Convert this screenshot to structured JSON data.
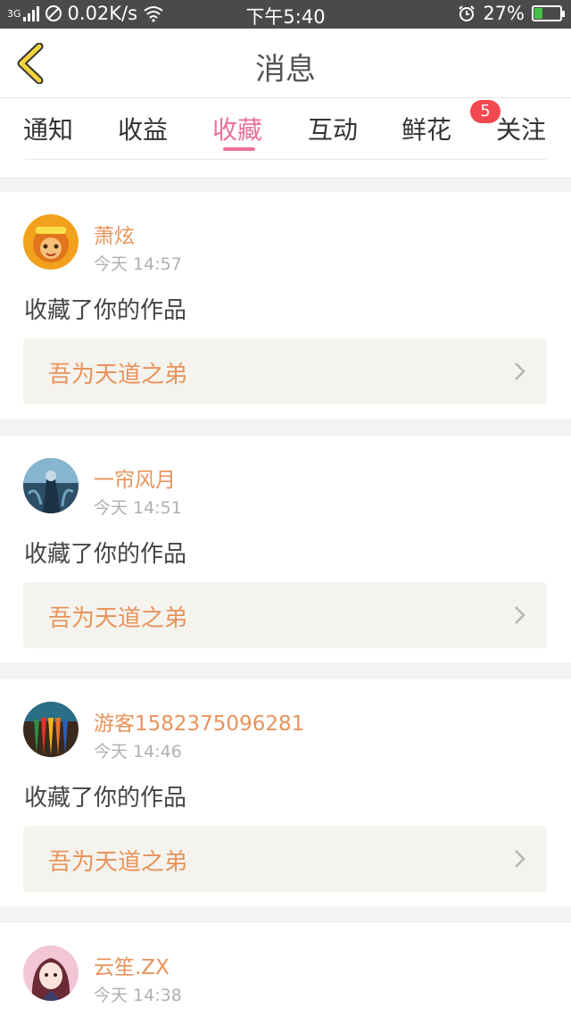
{
  "status_bar": {
    "network": "3G",
    "speed": "0.02K/s",
    "time": "下午5:40",
    "battery": "27%"
  },
  "header": {
    "title": "消息"
  },
  "tabs": [
    {
      "label": "通知"
    },
    {
      "label": "收益"
    },
    {
      "label": "收藏",
      "badge": "5"
    },
    {
      "label": "互动"
    },
    {
      "label": "鲜花"
    },
    {
      "label": "关注"
    }
  ],
  "messages": [
    {
      "user": "萧炫",
      "time": "今天 14:57",
      "action": "收藏了你的作品",
      "work": "吾为天道之弟"
    },
    {
      "user": "一帘风月",
      "time": "今天 14:51",
      "action": "收藏了你的作品",
      "work": "吾为天道之弟"
    },
    {
      "user": "游客1582375096281",
      "time": "今天 14:46",
      "action": "收藏了你的作品",
      "work": "吾为天道之弟"
    },
    {
      "user": "云笙.ZX",
      "time": "今天 14:38"
    }
  ],
  "colors": {
    "accent": "#e8719c",
    "username": "#e8935b",
    "badge": "#f2484f",
    "back_arrow": "#f5d33d"
  }
}
